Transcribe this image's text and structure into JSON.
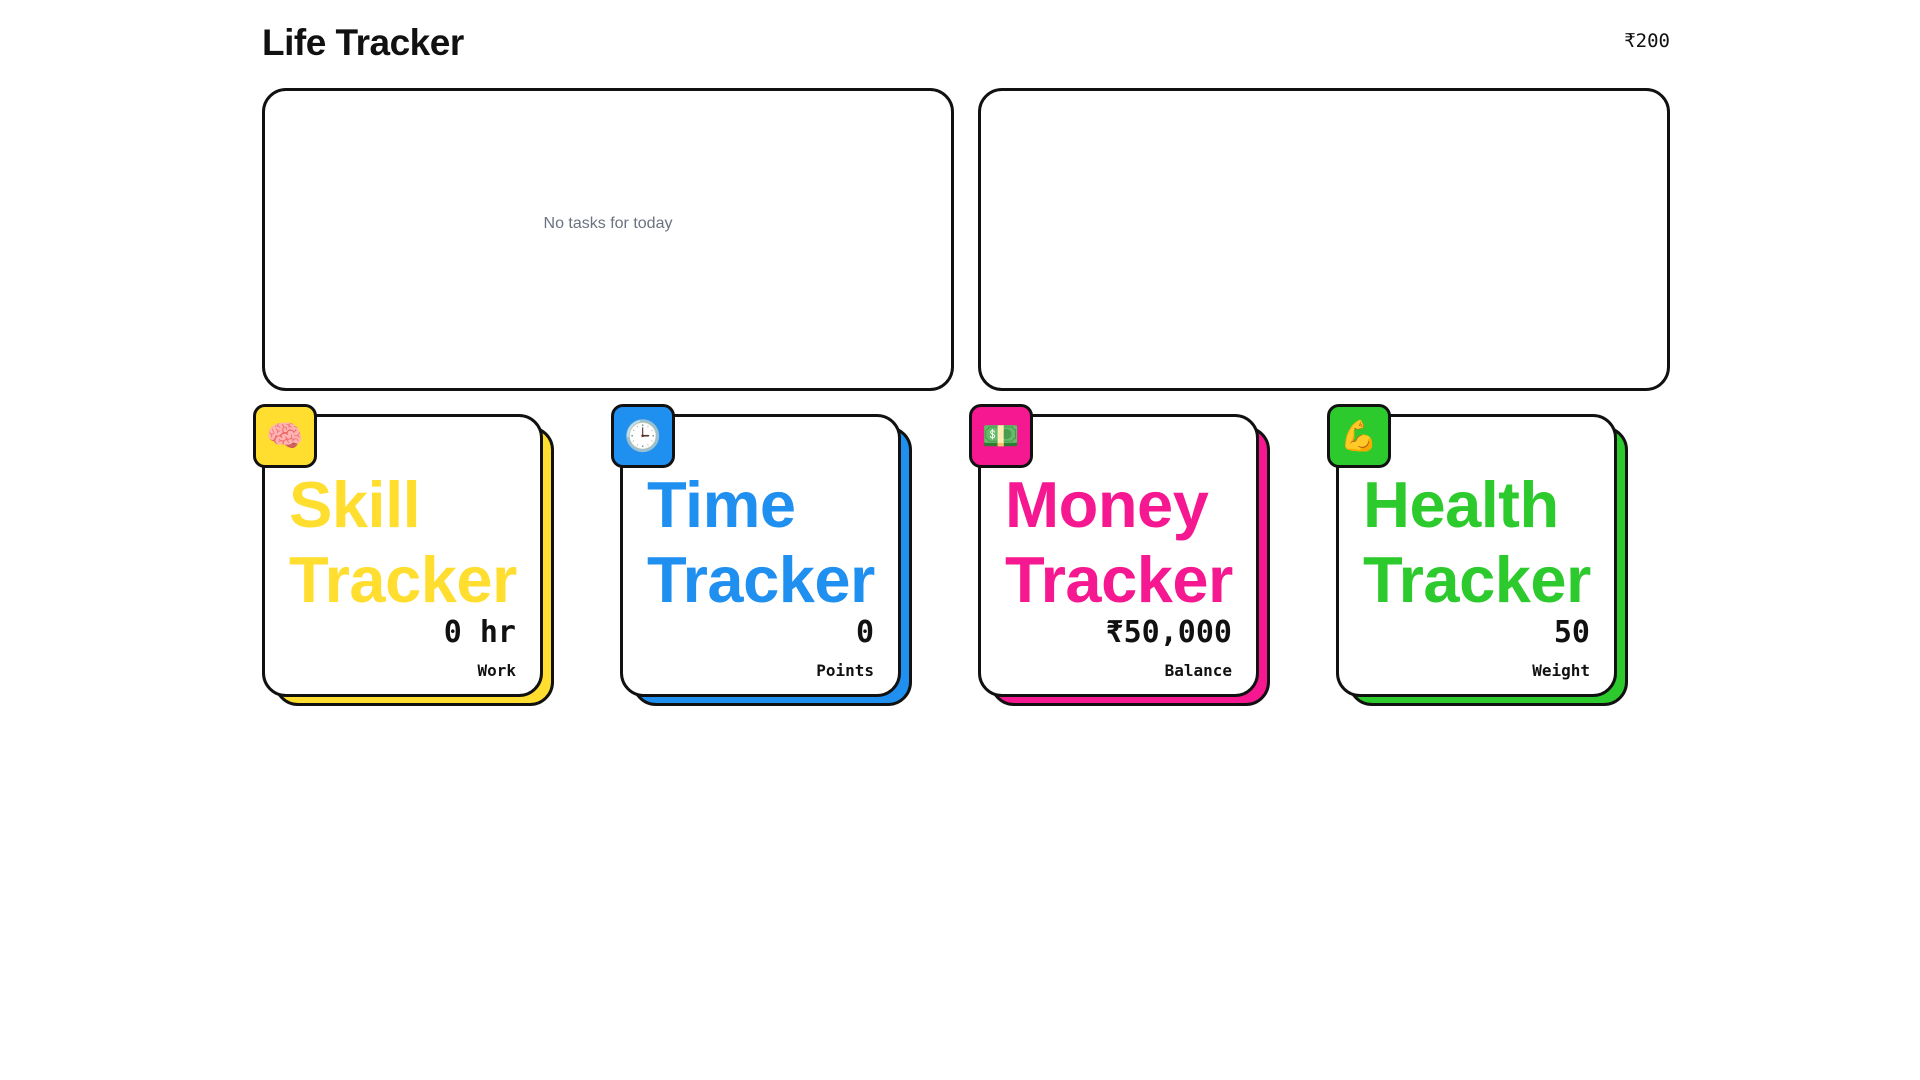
{
  "header": {
    "title": "Life Tracker",
    "balance": "₹200"
  },
  "panels": {
    "tasks_empty": "No tasks for today"
  },
  "trackers": [
    {
      "title_line1": "Skill",
      "title_line2": "Tracker",
      "value": "0 hr",
      "label": "Work",
      "icon": "brain-icon",
      "glyph": "🧠",
      "color": "#ffde30"
    },
    {
      "title_line1": "Time",
      "title_line2": "Tracker",
      "value": "0",
      "label": "Points",
      "icon": "clock-icon",
      "glyph": "🕒",
      "color": "#1f8ff0"
    },
    {
      "title_line1": "Money",
      "title_line2": "Tracker",
      "value": "₹50,000",
      "label": "Balance",
      "icon": "money-icon",
      "glyph": "💵",
      "color": "#f51890"
    },
    {
      "title_line1": "Health",
      "title_line2": "Tracker",
      "value": "50",
      "label": "Weight",
      "icon": "flexed-biceps-icon",
      "glyph": "💪",
      "color": "#2dca2d"
    }
  ]
}
